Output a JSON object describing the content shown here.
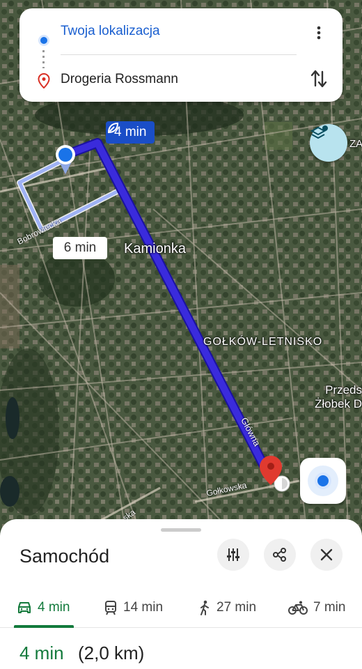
{
  "search": {
    "origin": "Twoja lokalizacja",
    "destination": "Drogeria Rossmann"
  },
  "map": {
    "district_label": "Kamionka",
    "area_label": "GOŁKÓW-LETNISKO",
    "poi_line1": "Przeds",
    "poi_line2": "Żłobek D",
    "edge_label": "ZA",
    "road_bobrowiecka": "Bobrowiecka",
    "road_glowna": "Główna",
    "road_golkowska": "Gołkowska",
    "road_bottom": "ska",
    "primary_time": "4 min",
    "alt_time": "6 min",
    "route_color": "#3a2bdc"
  },
  "sheet": {
    "mode_title": "Samochód",
    "tabs": [
      {
        "icon": "car-icon",
        "label": "4 min"
      },
      {
        "icon": "transit-icon",
        "label": "14 min"
      },
      {
        "icon": "walk-icon",
        "label": "27 min"
      },
      {
        "icon": "bike-icon",
        "label": "7 min"
      }
    ],
    "duration": "4 min",
    "distance": "(2,0 km)"
  },
  "colors": {
    "accent_green": "#137a3c",
    "accent_blue": "#1a73e8"
  }
}
